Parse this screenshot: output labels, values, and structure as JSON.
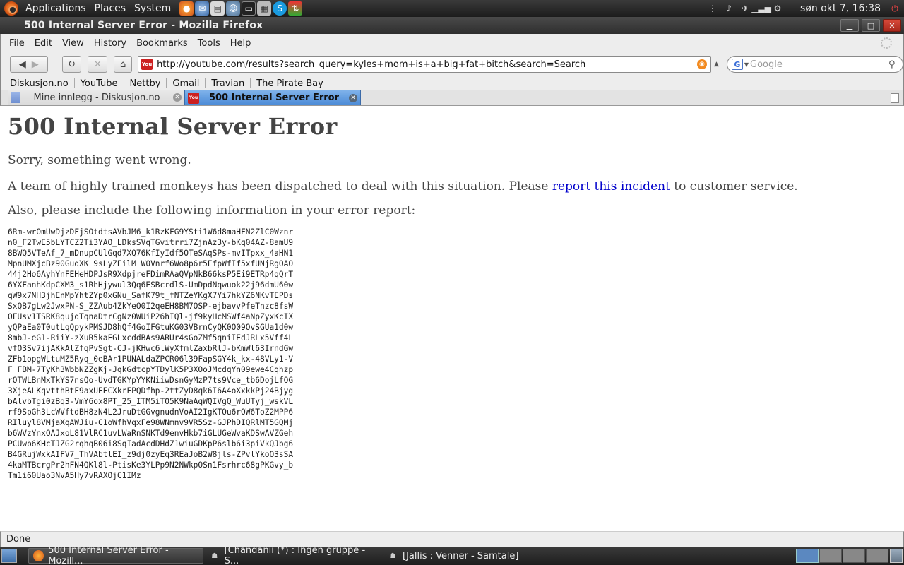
{
  "panel": {
    "menus": [
      "Applications",
      "Places",
      "System"
    ],
    "launchers": [
      "firefox-icon",
      "thunderbird-icon",
      "text-editor-icon",
      "people-icon",
      "terminal-icon",
      "calculator-icon",
      "skype-icon",
      "network-icon"
    ],
    "clock": "søn okt  7, 16:38"
  },
  "window": {
    "title": "500 Internal Server Error - Mozilla Firefox"
  },
  "menubar": [
    "File",
    "Edit",
    "View",
    "History",
    "Bookmarks",
    "Tools",
    "Help"
  ],
  "navbar": {
    "url": "http://youtube.com/results?search_query=kyles+mom+is+a+big+fat+bitch&search=Search",
    "search_placeholder": "Google"
  },
  "bookmarks": [
    "Diskusjon.no",
    "YouTube",
    "Nettby",
    "Gmail",
    "Travian",
    "The Pirate Bay"
  ],
  "tabs": [
    {
      "label": "Mine innlegg - Diskusjon.no",
      "active": false
    },
    {
      "label": "500 Internal Server Error",
      "active": true
    }
  ],
  "content": {
    "heading": "500 Internal Server Error",
    "sorry": "Sorry, something went wrong.",
    "monkeys_before": "A team of highly trained monkeys has been dispatched to deal with this situation. Please ",
    "report_link": "report this incident",
    "monkeys_after": " to customer service.",
    "include_info": "Also, please include the following information in your error report:",
    "error_lines": [
      "6Rm-wrOmUwDjzDFjSOtdtsAVbJM6_k1RzKFG9YSti1W6d8maHFN2ZlC0Wznr",
      "n0_F2TwE5bLYTCZ2Ti3YAO_LDksSVqTGvitrri7ZjnAz3y-bKq04AZ-8amU9",
      "8BWQ5VTeAf_7_mDnupCUlGqd7XQ76KfIyIdf5OTeSAqSPs-mvITpxx_4aHN1",
      "MpnUMXjcBz90GuqXK_9sLyZEilM_W0Vnrf6Wo8p6r5EfpWfIf5xfUNjRgOAO",
      "44j2Ho6AyhYnFEHeHDPJsR9XdpjreFDimRAaQVpNkB66ksP5Ei9ETRp4qQrT",
      "6YXFanhKdpCXM3_s1RhHjywul3Qq6ESBcrdlS-UmDpdNqwuok22j96dmU60w",
      "qW9x7NH3jhEnMpYhtZYp0xGNu_SafK79t_fNTZeYKgX7Yi7hkYZ6NKvTEPDs",
      "SxQB7gLw2JwxPN-S_ZZAub4ZkYeO0I2qeEH8BM7OSP-ejbavvPfeTnzc8fsW",
      "OFUsv1TSRK8qujqTqnaDtrCgNz0WUiP26hIQl-jf9kyHcMSWf4aNpZyxKcIX",
      "yQPaEa0T0utLqQpykPMSJD8hQf4GoIFGtuKG03VBrnCyQK0O09OvSGUa1d0w",
      "8mbJ-eG1-RiiY-zXuR5kaFGLxcddBAs9ARUr4sGoZMf5qniIEdJRLx5Vff4L",
      "vfO3Sv7ijAKkAlZfqPvSgt-CJ-jKHwc6lWyXfmlZaxbRlJ-bKmWl63IrndGw",
      "ZFb1opgWLtuMZ5Ryq_0eBAr1PUNALdaZPCR06l39FapSGY4k_kx-48VLy1-V",
      "F_FBM-7TyKh3WbbNZZgKj-JqkGdtcpYTDylK5P3XOoJMcdqYn09ewe4Cqhzp",
      "rOTWLBnMxTkYS7nsQo-UvdTGKYpYYKNiiwDsnGyMzP7ts9Vce_tb6DojLfQG",
      "3XjeALKqvtthBtF9axUEECXkrFPQDfhp-2ttZyD8qk6I6A4oXxkkPj24Bjyg",
      "bAlvbTgi0zBq3-VmY6ox8PT_25_ITM5iTO5K9NaAqWQIVgQ_WuUTyj_wskVL",
      "rf9SpGh3LcWVftdBH8zN4L2JruDtGGvgnudnVoAI2IgKTOu6rOW6ToZ2MPP6",
      "RIluyl8VMjaXqAWJiu-C1oWfhVqxFe98WNmnv9VR5Sz-GJPhDIQRlMT5GQMj",
      "b6WVzYnxQAJxoL81VlRC1uvLWaRnSNKTd9envHkb7iGLUGeWvaKDSwAVZGeh",
      "PCUwb6KHcTJZG2rqhqB06i8SqIadAcdDHdZ1wiuGDKpP6slb6i3piVkQJbg6",
      "B4GRujWxkAIFV7_ThVAbtlEI_z9dj0zyEq3REaJoB2W8jls-ZPvlYkoO3sSA",
      "4kaMTBcrgPr2hFN4QKl8l-PtisKe3YLPp9N2NWkpOSn1Fsrhrc68gPKGvy_b",
      "Tm1i60Uao3NvA5Hy7vRAXOjC1IMz"
    ]
  },
  "status": "Done",
  "taskbar": {
    "tasks": [
      {
        "label": "500 Internal Server Error - Mozill...",
        "icon": "firefox-icon"
      },
      {
        "label": "[Chandanii (*) : Ingen gruppe - S...",
        "icon": "chat-icon"
      },
      {
        "label": "[Jallis : Venner - Samtale]",
        "icon": "chat-icon"
      }
    ]
  },
  "colors": {
    "link": "#0000cc",
    "active_tab": "#4a8ad6",
    "panel": "#2b2b2b"
  }
}
